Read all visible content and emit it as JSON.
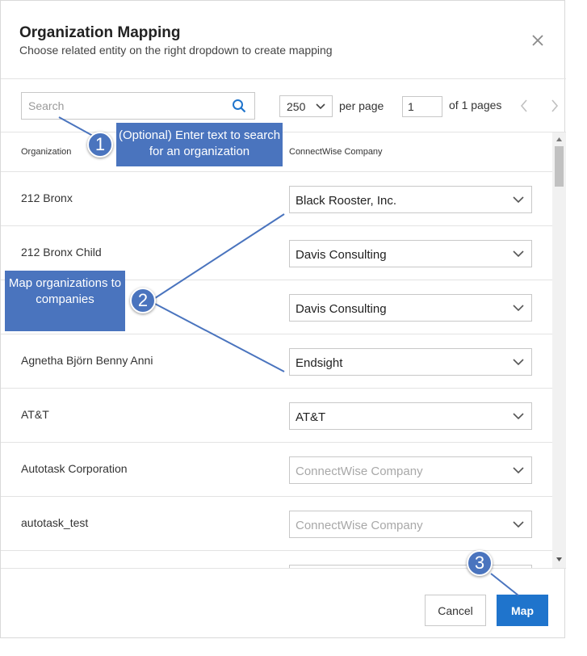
{
  "dialog": {
    "title": "Organization Mapping",
    "subtitle": "Choose related entity on the right dropdown to create mapping",
    "close_icon": "close-icon"
  },
  "toolbar": {
    "search_placeholder": "Search",
    "search_value": "",
    "per_page_value": "250",
    "per_page_label": "per page",
    "page_value": "1",
    "page_of_label": "of 1 pages"
  },
  "table": {
    "headers": {
      "organization": "Organization",
      "connectwise_company": "ConnectWise Company"
    },
    "rows": [
      {
        "organization": "212 Bronx",
        "company": "Black Rooster, Inc.",
        "is_placeholder": false
      },
      {
        "organization": "212 Bronx Child",
        "company": "Davis Consulting",
        "is_placeholder": false
      },
      {
        "organization": "",
        "company": "Davis Consulting",
        "is_placeholder": false
      },
      {
        "organization": "Agnetha Björn Benny Anni",
        "company": "Endsight",
        "is_placeholder": false
      },
      {
        "organization": "AT&T",
        "company": "AT&T",
        "is_placeholder": false
      },
      {
        "organization": "Autotask Corporation",
        "company": "ConnectWise Company",
        "is_placeholder": true
      },
      {
        "organization": "autotask_test",
        "company": "ConnectWise Company",
        "is_placeholder": true
      },
      {
        "organization": "",
        "company": "",
        "is_placeholder": false
      }
    ]
  },
  "footer": {
    "cancel_label": "Cancel",
    "map_label": "Map"
  },
  "callouts": [
    {
      "number": "1",
      "text": "(Optional) Enter text to search for an organization"
    },
    {
      "number": "2",
      "text": "Map organizations to companies"
    },
    {
      "number": "3",
      "text": ""
    }
  ],
  "colors": {
    "primary_button": "#1f74cc",
    "callout": "#4a74be",
    "search_icon": "#1f74cc"
  }
}
